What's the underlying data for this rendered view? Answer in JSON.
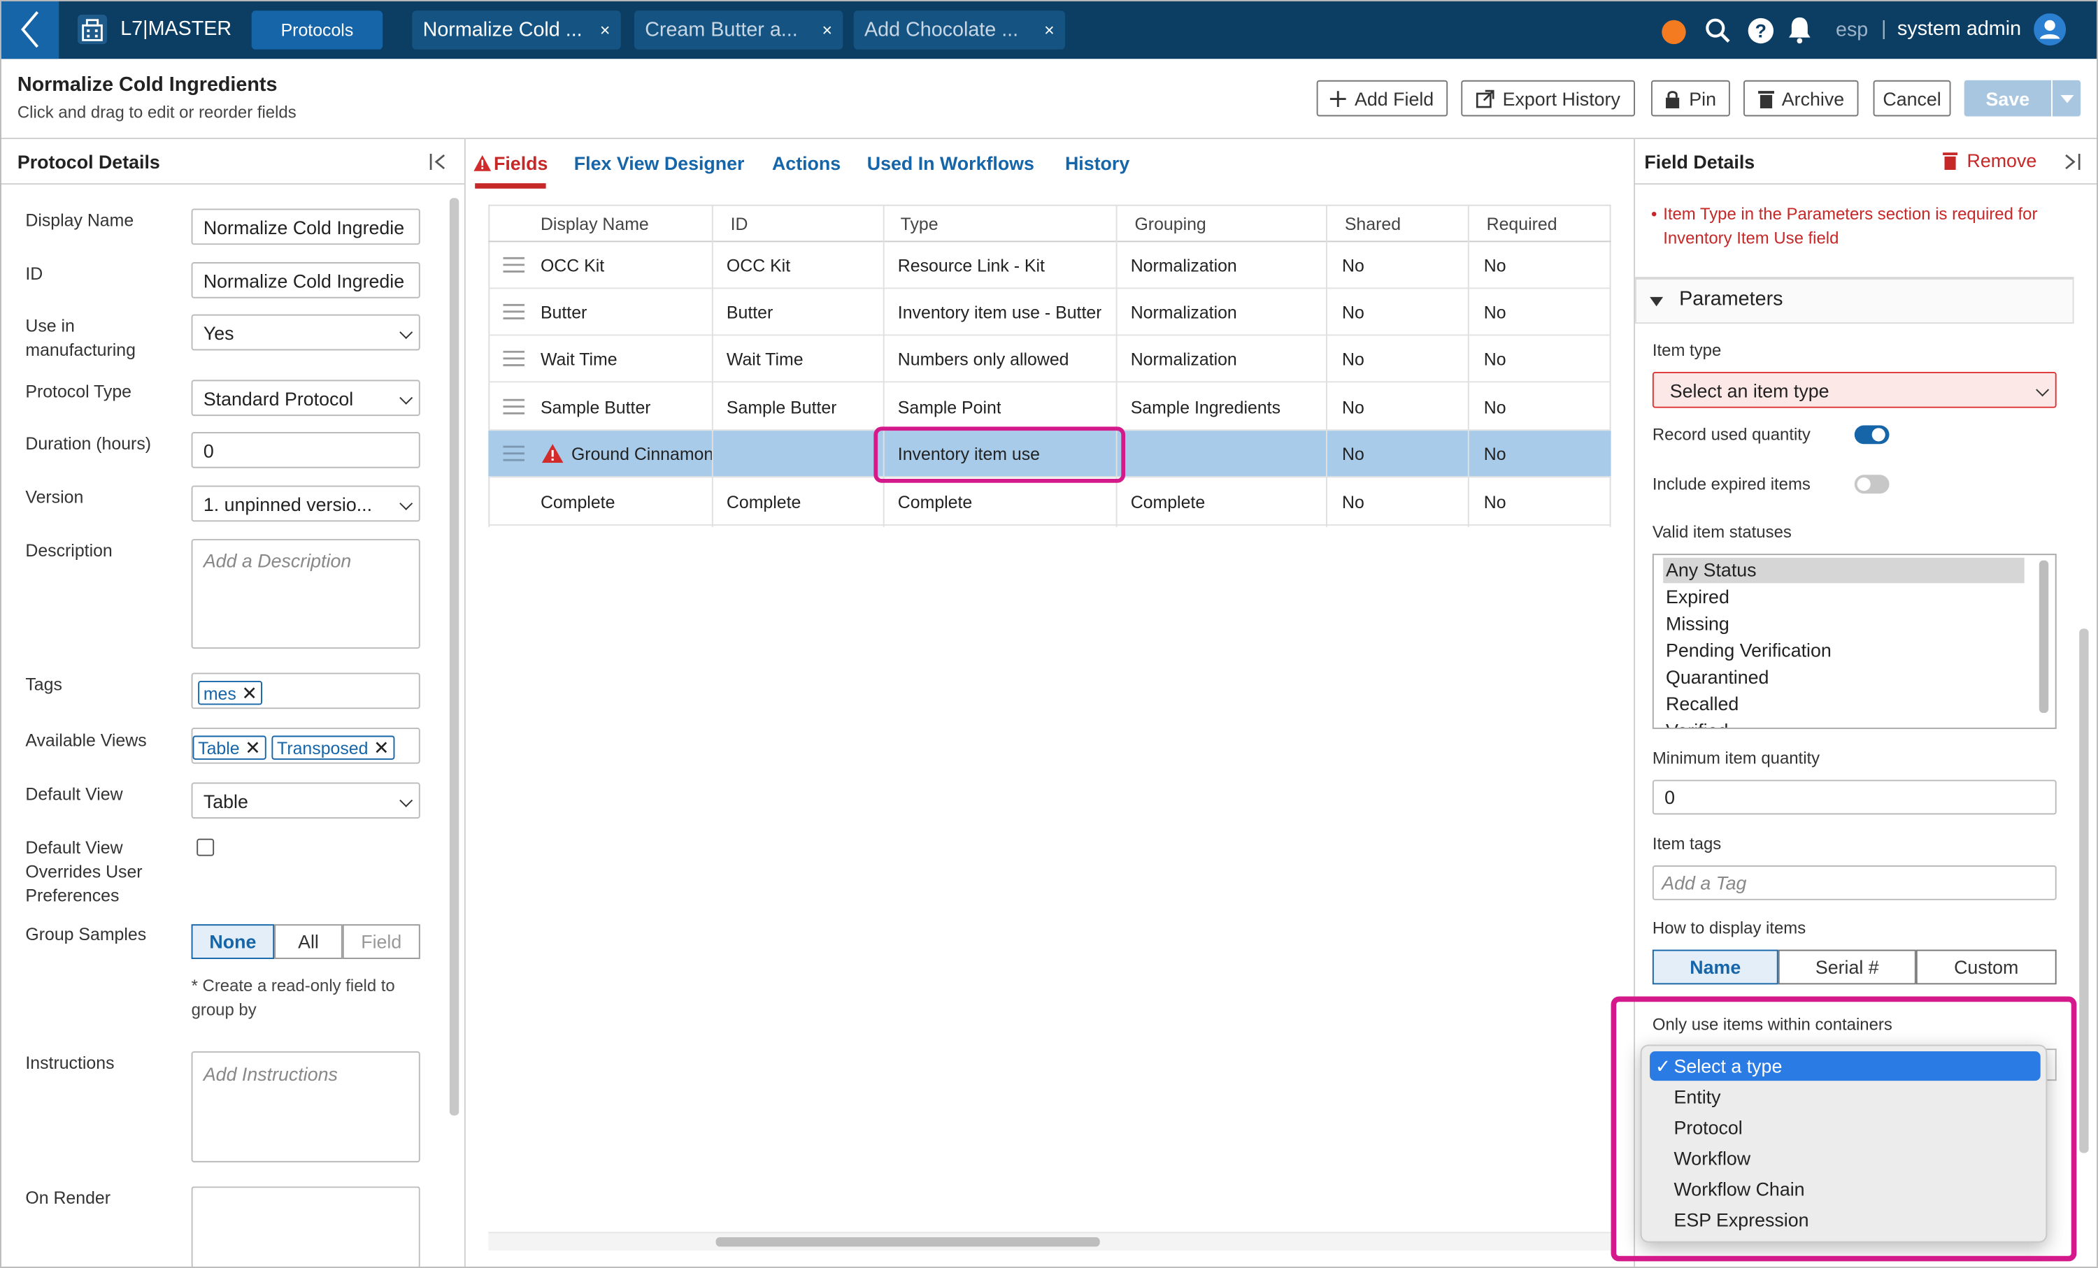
{
  "topbar": {
    "app_name": "L7|MASTER",
    "protocols_button": "Protocols",
    "tabs": [
      {
        "label": "Normalize Cold ...",
        "close": "×"
      },
      {
        "label": "Cream Butter a...",
        "close": "×"
      },
      {
        "label": "Add Chocolate ...",
        "close": "×"
      }
    ],
    "lang": "esp",
    "user": "system admin",
    "colors": {
      "bar": "#0c3d63",
      "accent": "#1565a8",
      "status_dot": "#f47b20"
    }
  },
  "header": {
    "title": "Normalize Cold Ingredients",
    "subtitle": "Click and drag to edit or reorder fields",
    "buttons": {
      "add_field": "Add Field",
      "export_history": "Export History",
      "pin": "Pin",
      "archive": "Archive",
      "cancel": "Cancel",
      "save": "Save"
    }
  },
  "left_panel": {
    "title": "Protocol Details",
    "fields": {
      "display_name": {
        "label": "Display Name",
        "value": "Normalize Cold Ingredie"
      },
      "id": {
        "label": "ID",
        "value": "Normalize Cold Ingredie"
      },
      "use_in_manufacturing": {
        "label": "Use in manufacturing",
        "value": "Yes"
      },
      "protocol_type": {
        "label": "Protocol Type",
        "value": "Standard Protocol"
      },
      "duration": {
        "label": "Duration (hours)",
        "value": "0"
      },
      "version": {
        "label": "Version",
        "value": "1. unpinned versio..."
      },
      "description": {
        "label": "Description",
        "placeholder": "Add a Description"
      },
      "tags": {
        "label": "Tags",
        "chips": [
          "mes"
        ]
      },
      "available_views": {
        "label": "Available Views",
        "chips": [
          "Table",
          "Transposed"
        ]
      },
      "default_view": {
        "label": "Default View",
        "value": "Table"
      },
      "default_view_overrides": {
        "label": "Default View Overrides User Preferences",
        "checked": false
      },
      "group_samples": {
        "label": "Group Samples",
        "options": [
          "None",
          "All",
          "Field"
        ],
        "selected": "None",
        "note": "* Create a read-only field to group by"
      },
      "instructions": {
        "label": "Instructions",
        "placeholder": "Add Instructions"
      },
      "on_render": {
        "label": "On Render"
      }
    }
  },
  "center": {
    "tabs": [
      "Fields",
      "Flex View Designer",
      "Actions",
      "Used In Workflows",
      "History"
    ],
    "active_tab": "Fields",
    "columns": [
      "Display Name",
      "ID",
      "Type",
      "Grouping",
      "Shared",
      "Required"
    ],
    "rows": [
      {
        "name": "OCC Kit",
        "id": "OCC Kit",
        "type": "Resource Link - Kit",
        "grouping": "Normalization",
        "shared": "No",
        "required": "No"
      },
      {
        "name": "Butter",
        "id": "Butter",
        "type": "Inventory item use - Butter",
        "grouping": "Normalization",
        "shared": "No",
        "required": "No"
      },
      {
        "name": "Wait Time",
        "id": "Wait Time",
        "type": "Numbers only allowed",
        "grouping": "Normalization",
        "shared": "No",
        "required": "No"
      },
      {
        "name": "Sample Butter",
        "id": "Sample Butter",
        "type": "Sample Point",
        "grouping": "Sample Ingredients",
        "shared": "No",
        "required": "No"
      },
      {
        "name": "Ground Cinnamon",
        "id": "",
        "type": "Inventory item use",
        "grouping": "",
        "shared": "No",
        "required": "No",
        "selected": true,
        "warning": true
      },
      {
        "name": "Complete",
        "id": "Complete",
        "type": "Complete",
        "grouping": "Complete",
        "shared": "No",
        "required": "No"
      }
    ]
  },
  "right_panel": {
    "title": "Field Details",
    "remove": "Remove",
    "error": "Item Type in the Parameters section is required for Inventory Item Use field",
    "section": "Parameters",
    "item_type": {
      "label": "Item type",
      "placeholder": "Select an item type"
    },
    "record_used_quantity": {
      "label": "Record used quantity",
      "on": true
    },
    "include_expired": {
      "label": "Include expired items",
      "on": false
    },
    "valid_statuses": {
      "label": "Valid item statuses",
      "options": [
        "Any Status",
        "Expired",
        "Missing",
        "Pending Verification",
        "Quarantined",
        "Recalled",
        "Verified"
      ],
      "selected": "Any Status"
    },
    "min_quantity": {
      "label": "Minimum item quantity",
      "value": "0"
    },
    "item_tags": {
      "label": "Item tags",
      "placeholder": "Add a Tag"
    },
    "display_items": {
      "label": "How to display items",
      "options": [
        "Name",
        "Serial #",
        "Custom"
      ],
      "selected": "Name"
    },
    "containers": {
      "label": "Only use items within containers"
    },
    "dropdown": {
      "check": "✓",
      "options": [
        "Select a type",
        "Entity",
        "Protocol",
        "Workflow",
        "Workflow Chain",
        "ESP Expression"
      ],
      "selected": "Select a type"
    }
  }
}
